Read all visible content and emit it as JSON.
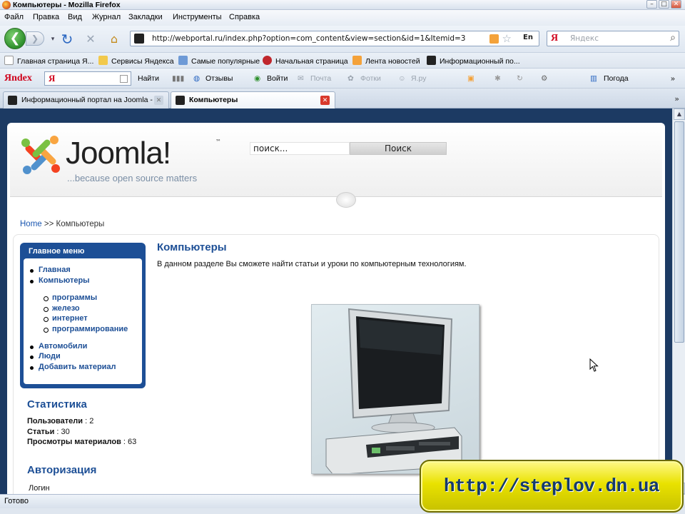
{
  "window": {
    "title": "Компьютеры - Mozilla Firefox"
  },
  "menu": [
    "Файл",
    "Правка",
    "Вид",
    "Журнал",
    "Закладки",
    "Инструменты",
    "Справка"
  ],
  "nav": {
    "url": "http://webportal.ru/index.php?option=com_content&view=section&id=1&Itemid=3",
    "lang": "En",
    "search_placeholder": "Яндекс",
    "search_engine_glyph": "Я"
  },
  "bookmarks": [
    "Главная страница Я...",
    "Сервисы Яндекса",
    "Самые популярные",
    "Начальная страница",
    "Лента новостей",
    "Информационный по..."
  ],
  "yandex_bar": {
    "logo": "Яndex",
    "input_glyph": "Я",
    "find": "Найти",
    "reviews": "Отзывы",
    "login": "Войти",
    "mail": "Почта",
    "photos": "Фотки",
    "yaru": "Я.ру",
    "weather": "Погода"
  },
  "tabs": [
    {
      "label": "Информационный портал на Joomla - ...",
      "active": false
    },
    {
      "label": "Компьютеры",
      "active": true
    }
  ],
  "site": {
    "logo_text": "Joomla!",
    "tm": "™",
    "slogan": "...because open source matters",
    "search_value": "поиск...",
    "search_button": "Поиск"
  },
  "breadcrumb": {
    "home": "Home",
    "separator": ">>",
    "current": "Компьютеры"
  },
  "main_menu": {
    "title": "Главное меню",
    "items": [
      "Главная",
      "Компьютеры"
    ],
    "subitems": [
      "программы",
      "железо",
      "интернет",
      "программирование"
    ],
    "items_after": [
      "Автомобили",
      "Люди",
      "Добавить материал"
    ]
  },
  "statistics": {
    "title": "Статистика",
    "rows": [
      {
        "label": "Пользователи",
        "value": "2"
      },
      {
        "label": "Статьи",
        "value": "30"
      },
      {
        "label": "Просмотры материалов",
        "value": "63"
      }
    ]
  },
  "auth": {
    "title": "Авторизация",
    "login_label": "Логин"
  },
  "article": {
    "title": "Компьютеры",
    "description": "В данном разделе Вы сможете найти статьи и уроки по компьютерным технологиям."
  },
  "status": "Готово",
  "banner": "http://steplov.dn.ua",
  "colors": {
    "link": "#1b57b1",
    "menu_blue": "#1d4f96",
    "banner_yellow": "#e9e200"
  }
}
